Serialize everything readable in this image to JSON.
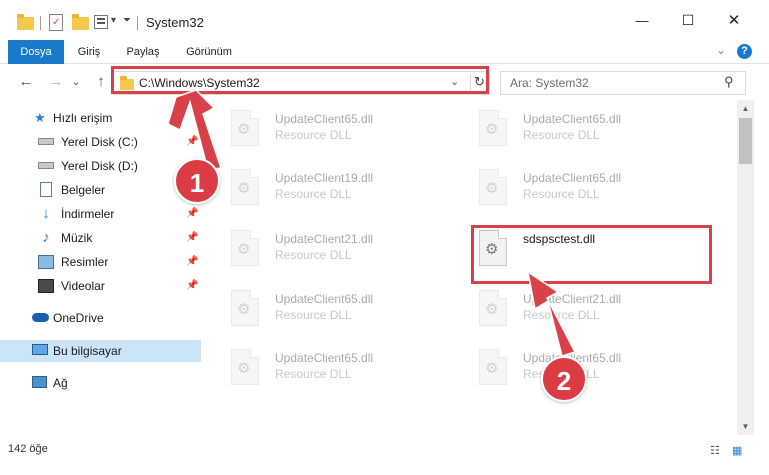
{
  "window": {
    "title": "System32",
    "minimize_glyph": "—",
    "maximize_glyph": "☐",
    "close_glyph": "✕"
  },
  "quick_access_toolbar": {
    "dropdown_glyph": "▾",
    "customize_glyph": "⏷"
  },
  "ribbon": {
    "tabs": [
      "Dosya",
      "Giriş",
      "Paylaş",
      "Görünüm"
    ],
    "expand_glyph": "⌄",
    "help_glyph": "?"
  },
  "navigation": {
    "back_glyph": "←",
    "forward_glyph": "→",
    "recent_glyph": "⌄",
    "up_glyph": "↑"
  },
  "address_bar": {
    "path": "C:\\Windows\\System32",
    "dropdown_glyph": "⌄",
    "refresh_glyph": "↻"
  },
  "search": {
    "placeholder": "Ara: System32",
    "icon_glyph": "⚲"
  },
  "sidebar": {
    "items": [
      {
        "label": "Hızlı erişim",
        "icon": "star-icon"
      },
      {
        "label": "Yerel Disk (C:)",
        "icon": "drive-icon",
        "pinned": true
      },
      {
        "label": "Yerel Disk (D:)",
        "icon": "drive-icon",
        "pinned": true
      },
      {
        "label": "Belgeler",
        "icon": "documents-icon",
        "pinned": true
      },
      {
        "label": "İndirmeler",
        "icon": "downloads-icon",
        "pinned": true
      },
      {
        "label": "Müzik",
        "icon": "music-icon",
        "pinned": true
      },
      {
        "label": "Resimler",
        "icon": "pictures-icon",
        "pinned": true
      },
      {
        "label": "Videolar",
        "icon": "videos-icon",
        "pinned": true
      },
      {
        "label": "OneDrive",
        "icon": "cloud-icon"
      },
      {
        "label": "Bu bilgisayar",
        "icon": "computer-icon",
        "selected": true
      },
      {
        "label": "Ağ",
        "icon": "network-icon"
      }
    ],
    "pin_glyph": "📌"
  },
  "files": [
    {
      "name": "UpdateClient65.dll",
      "type": "Resource DLL"
    },
    {
      "name": "UpdateClient65.dll",
      "type": "Resource DLL"
    },
    {
      "name": "UpdateClient19.dll",
      "type": "Resource DLL"
    },
    {
      "name": "UpdateClient65.dll",
      "type": "Resource DLL"
    },
    {
      "name": "UpdateClient21.dll",
      "type": "Resource DLL"
    },
    {
      "name": "sdspsctest.dll",
      "type": "",
      "highlighted": true
    },
    {
      "name": "UpdateClient65.dll",
      "type": "Resource DLL"
    },
    {
      "name": "UpdateClient21.dll",
      "type": "Resource DLL"
    },
    {
      "name": "UpdateClient65.dll",
      "type": "Resource DLL"
    },
    {
      "name": "UpdateClient65.dll",
      "type": "Resource DLL"
    }
  ],
  "scrollbar": {
    "up_glyph": "▲",
    "down_glyph": "▼"
  },
  "status_bar": {
    "item_count": "142 öğe",
    "details_view_glyph": "☷",
    "large_icons_glyph": "▦"
  },
  "annotations": {
    "step1": "1",
    "step2": "2",
    "accent_color": "#d94148"
  }
}
